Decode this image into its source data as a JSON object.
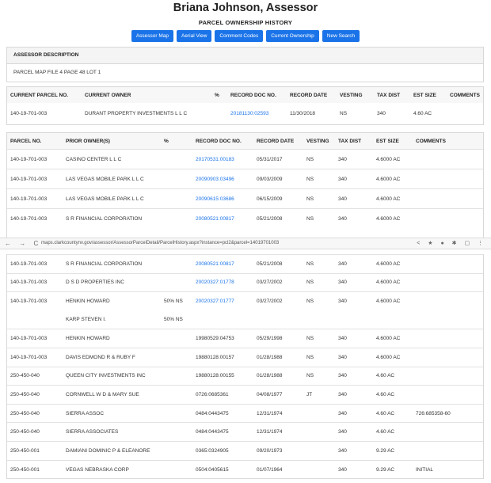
{
  "header": {
    "title": "Briana Johnson, Assessor",
    "subtitle": "PARCEL OWNERSHIP HISTORY",
    "buttons": [
      "Assessor Map",
      "Aerial View",
      "Comment Codes",
      "Current Ownership",
      "New Search"
    ]
  },
  "assessor": {
    "heading": "ASSESSOR DESCRIPTION",
    "description": "PARCEL MAP FILE 4 PAGE 48 LOT 1"
  },
  "current": {
    "headers": [
      "CURRENT PARCEL NO.",
      "CURRENT OWNER",
      "%",
      "RECORD DOC NO.",
      "RECORD DATE",
      "VESTING",
      "TAX DIST",
      "EST SIZE",
      "COMMENTS"
    ],
    "row": [
      "140-19-701-003",
      "DURANT PROPERTY INVESTMENTS L L C",
      "",
      "20181130:02593",
      "11/30/2018",
      "NS",
      "340",
      "4.60 AC",
      ""
    ]
  },
  "history_headers": [
    "PARCEL NO.",
    "PRIOR OWNER(S)",
    "%",
    "RECORD DOC NO.",
    "RECORD DATE",
    "VESTING",
    "TAX DIST",
    "EST SIZE",
    "COMMENTS"
  ],
  "history_top": [
    [
      "140-19-701-003",
      "CASINO CENTER L L C",
      "",
      "20170531:00183",
      "05/31/2017",
      "NS",
      "340",
      "4.6000 AC",
      ""
    ],
    [
      "140-19-701-003",
      "LAS VEGAS MOBILE PARK L L C",
      "",
      "20090903:03496",
      "09/03/2009",
      "NS",
      "340",
      "4.6000 AC",
      ""
    ],
    [
      "140-19-701-003",
      "LAS VEGAS MOBILE PARK L L C",
      "",
      "20090615:03686",
      "06/15/2009",
      "NS",
      "340",
      "4.6000 AC",
      ""
    ],
    [
      "140-19-701-003",
      "S R FINANCIAL CORPORATION",
      "",
      "20080521:00817",
      "05/21/2008",
      "NS",
      "340",
      "4.6000 AC",
      ""
    ]
  ],
  "browser": {
    "nav": "← → C",
    "url": "maps.clarkcountynv.gov/assessor/AssessorParcelDetail/ParcelHistory.aspx?instance=pcl2&parcel=14019701003",
    "ext": "< ★ ● ✱ ▢ ⋮"
  },
  "history_bottom": [
    {
      "cells": [
        "140-19-701-003",
        "S R FINANCIAL CORPORATION",
        "",
        "20080521:00817",
        "05/21/2008",
        "NS",
        "340",
        "4.6000 AC",
        ""
      ],
      "link": true,
      "sep": true
    },
    {
      "cells": [
        "140-19-701-003",
        "D S D PROPERTIES INC",
        "",
        "20020327:01778",
        "03/27/2002",
        "NS",
        "340",
        "4.6000 AC",
        ""
      ],
      "link": true,
      "sep": true
    },
    {
      "cells": [
        "140-19-701-003",
        "HENKIN HOWARD",
        "50% NS",
        "20020327:01777",
        "03/27/2002",
        "NS",
        "340",
        "4.6000 AC",
        ""
      ],
      "link": true,
      "sep": true
    },
    {
      "cells": [
        "",
        "KARP STEVEN I.",
        "50% NS",
        "",
        "",
        "",
        "",
        "",
        ""
      ],
      "link": false,
      "sep": false
    },
    {
      "cells": [
        "140-19-701-003",
        "HENKIN HOWARD",
        "",
        "19980529:04753",
        "05/29/1998",
        "NS",
        "340",
        "4.6000 AC",
        ""
      ],
      "link": false,
      "sep": true
    },
    {
      "cells": [
        "140-19-701-003",
        "DAVIS EDMOND R & RUBY F",
        "",
        "19880128:00157",
        "01/28/1988",
        "NS",
        "340",
        "4.6000 AC",
        ""
      ],
      "link": false,
      "sep": true
    },
    {
      "cells": [
        "250-450-040",
        "QUEEN CITY INVESTMENTS INC",
        "",
        "19880128:00155",
        "01/28/1988",
        "NS",
        "340",
        "4.60 AC",
        ""
      ],
      "link": false,
      "sep": true
    },
    {
      "cells": [
        "250-450-040",
        "CORNWELL W D & MARY SUE",
        "",
        "0726:0685361",
        "04/08/1977",
        "JT",
        "340",
        "4.60 AC",
        ""
      ],
      "link": false,
      "sep": true
    },
    {
      "cells": [
        "250-450-040",
        "SIERRA ASSOC",
        "",
        "0484:0443475",
        "12/31/1974",
        "",
        "340",
        "4.60 AC",
        "726:685358-60"
      ],
      "link": false,
      "sep": true
    },
    {
      "cells": [
        "250-450-040",
        "SIERRA ASSOCIATES",
        "",
        "0484:0443475",
        "12/31/1974",
        "",
        "340",
        "4.60 AC",
        ""
      ],
      "link": false,
      "sep": true
    },
    {
      "cells": [
        "250-450-001",
        "DAMIANI DOMINIC P & ELEANORE",
        "",
        "0365:0324905",
        "09/20/1973",
        "",
        "340",
        "9.29 AC",
        ""
      ],
      "link": false,
      "sep": true
    },
    {
      "cells": [
        "250-450-001",
        "VEGAS NEBRASKA CORP",
        "",
        "0504:0405615",
        "01/07/1964",
        "",
        "340",
        "9.29 AC",
        "INITIAL"
      ],
      "link": false,
      "sep": true
    }
  ]
}
